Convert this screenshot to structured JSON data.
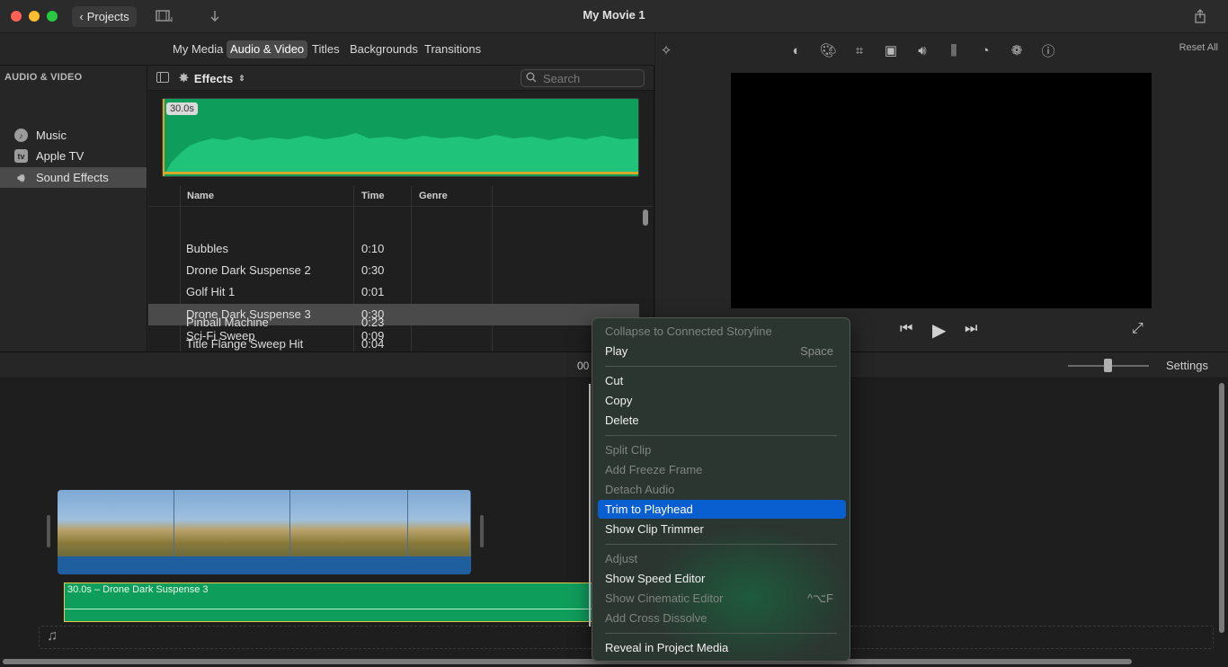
{
  "window": {
    "title": "My Movie 1",
    "projects_label": "Projects"
  },
  "media_tabs": [
    "My Media",
    "Audio & Video",
    "Titles",
    "Backgrounds",
    "Transitions"
  ],
  "sidebar": {
    "header": "AUDIO & VIDEO",
    "items": [
      {
        "label": "Music",
        "icon": "music-note-icon"
      },
      {
        "label": "Apple TV",
        "icon": "appletv-icon"
      },
      {
        "label": "Sound Effects",
        "icon": "speaker-icon",
        "selected": true
      }
    ]
  },
  "browser": {
    "category": "Effects",
    "search_placeholder": "Search",
    "preview_duration": "30.0s",
    "columns": [
      "Name",
      "Time",
      "Genre"
    ],
    "rows": [
      {
        "name": "Bubbles",
        "time": "0:10"
      },
      {
        "name": "Drone Dark Suspense 2",
        "time": "0:30"
      },
      {
        "name": "Golf Hit 1",
        "time": "0:01"
      },
      {
        "name": "Drone Dark Suspense 3",
        "time": "0:30",
        "selected": true
      },
      {
        "name": "Sci-Fi Sweep",
        "time": "0:09"
      },
      {
        "name": "Pinball Machine",
        "time": "0:23"
      },
      {
        "name": "Title Flange Sweep Hit",
        "time": "0:04"
      }
    ]
  },
  "viewer": {
    "reset_label": "Reset All"
  },
  "timeline": {
    "timecode": "00",
    "settings_label": "Settings",
    "audio_clip_label": "30.0s – Drone Dark Suspense 3"
  },
  "context_menu": {
    "items": [
      {
        "label": "Collapse to Connected Storyline",
        "disabled": true
      },
      {
        "label": "Play",
        "shortcut": "Space"
      },
      {
        "sep": true
      },
      {
        "label": "Cut"
      },
      {
        "label": "Copy"
      },
      {
        "label": "Delete"
      },
      {
        "sep": true
      },
      {
        "label": "Split Clip",
        "disabled": true
      },
      {
        "label": "Add Freeze Frame",
        "disabled": true
      },
      {
        "label": "Detach Audio",
        "disabled": true
      },
      {
        "label": "Trim to Playhead",
        "highlighted": true
      },
      {
        "label": "Show Clip Trimmer"
      },
      {
        "sep": true
      },
      {
        "label": "Adjust",
        "disabled": true
      },
      {
        "label": "Show Speed Editor"
      },
      {
        "label": "Show Cinematic Editor",
        "disabled": true,
        "shortcut": "^⌥F"
      },
      {
        "label": "Add Cross Dissolve",
        "disabled": true
      },
      {
        "sep": true
      },
      {
        "label": "Reveal in Project Media"
      }
    ]
  },
  "colors": {
    "accent": "#0a5fd0",
    "audio_green": "#0f9d5c",
    "clip_border": "#e8c84a"
  }
}
